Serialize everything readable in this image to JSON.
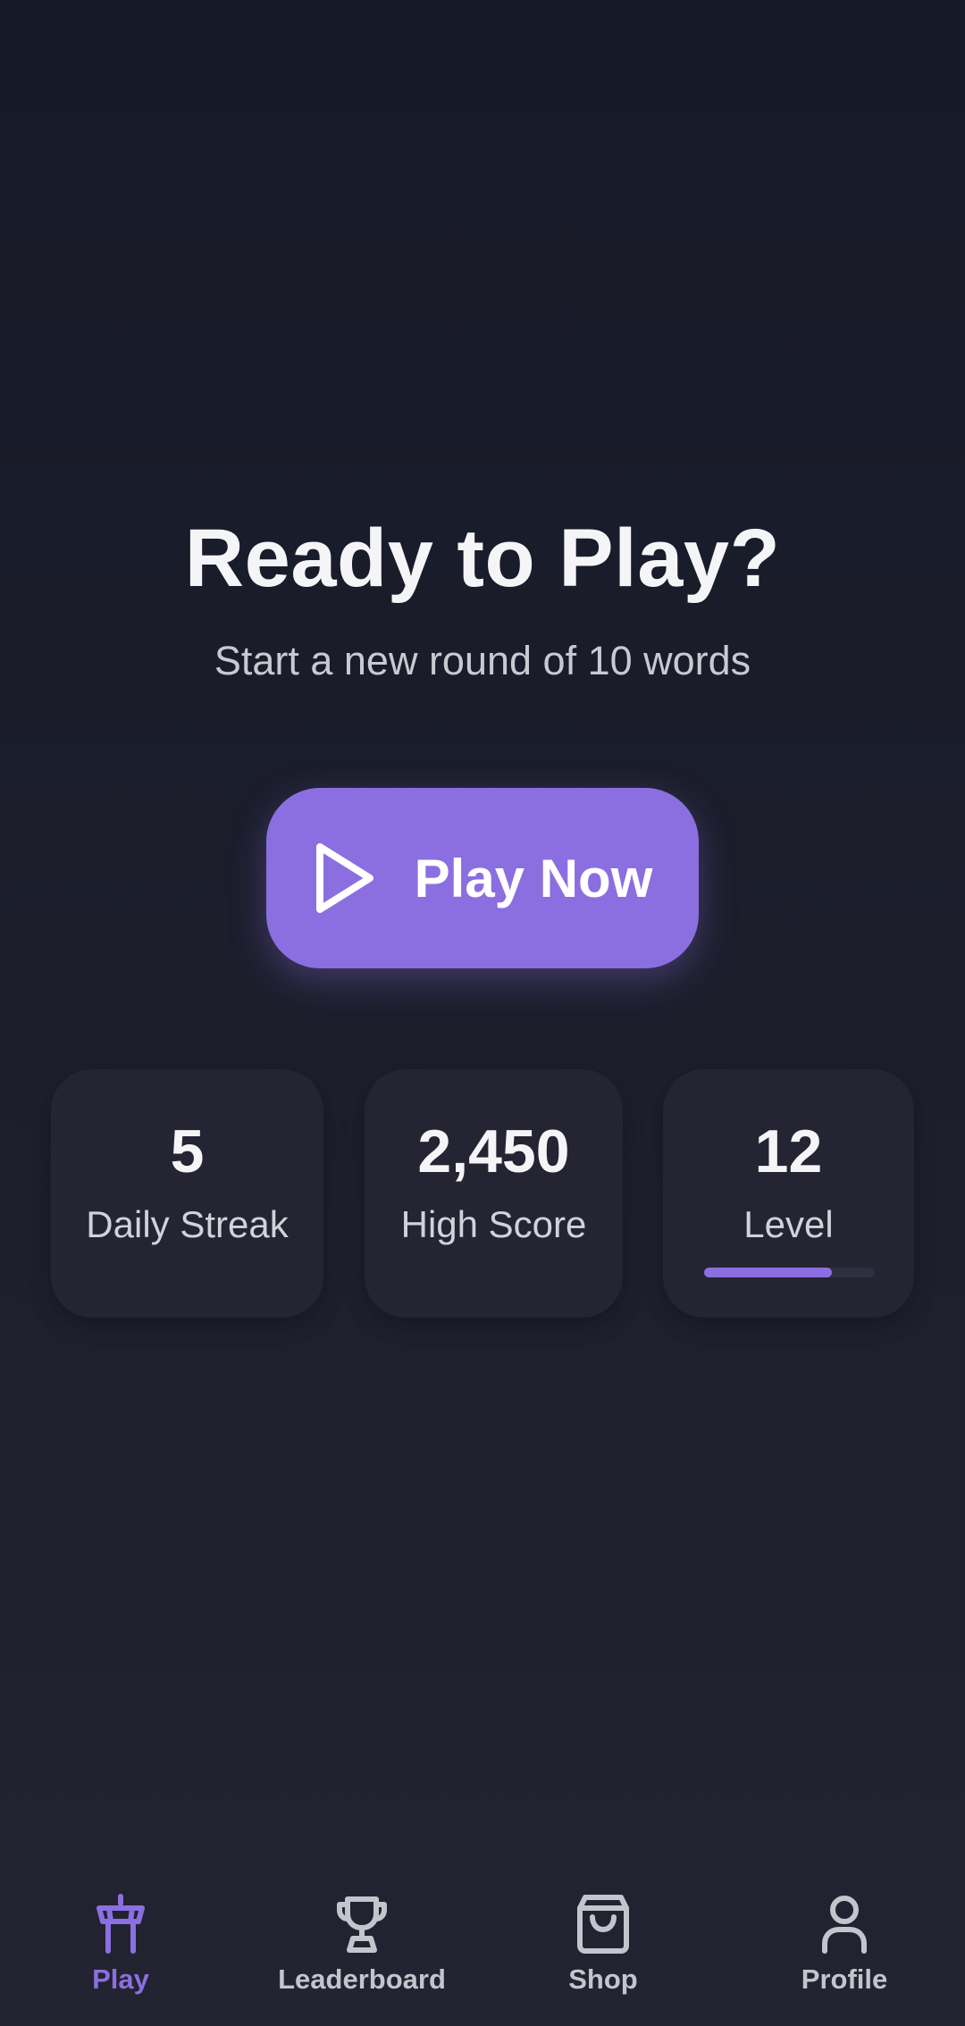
{
  "hero": {
    "title": "Ready to Play?",
    "subtitle": "Start a new round of 10 words"
  },
  "play_button": {
    "label": "Play Now",
    "icon": "play-icon"
  },
  "stats": {
    "streak": {
      "value": "5",
      "label": "Daily Streak"
    },
    "high_score": {
      "value": "2,450",
      "label": "High Score"
    },
    "level": {
      "value": "12",
      "label": "Level",
      "progress": 0.75
    }
  },
  "bottom_nav": {
    "items": [
      {
        "label": "Play",
        "icon": "tower-icon",
        "active": true
      },
      {
        "label": "Leaderboard",
        "icon": "trophy-icon",
        "active": false
      },
      {
        "label": "Shop",
        "icon": "shopping-bag-icon",
        "active": false
      },
      {
        "label": "Profile",
        "icon": "user-icon",
        "active": false
      }
    ]
  },
  "colors": {
    "accent": "#8b6fe0",
    "background_top": "#161927",
    "background_bottom": "#232331",
    "card": "#242433",
    "inactive_nav": "#c4c4cc"
  }
}
